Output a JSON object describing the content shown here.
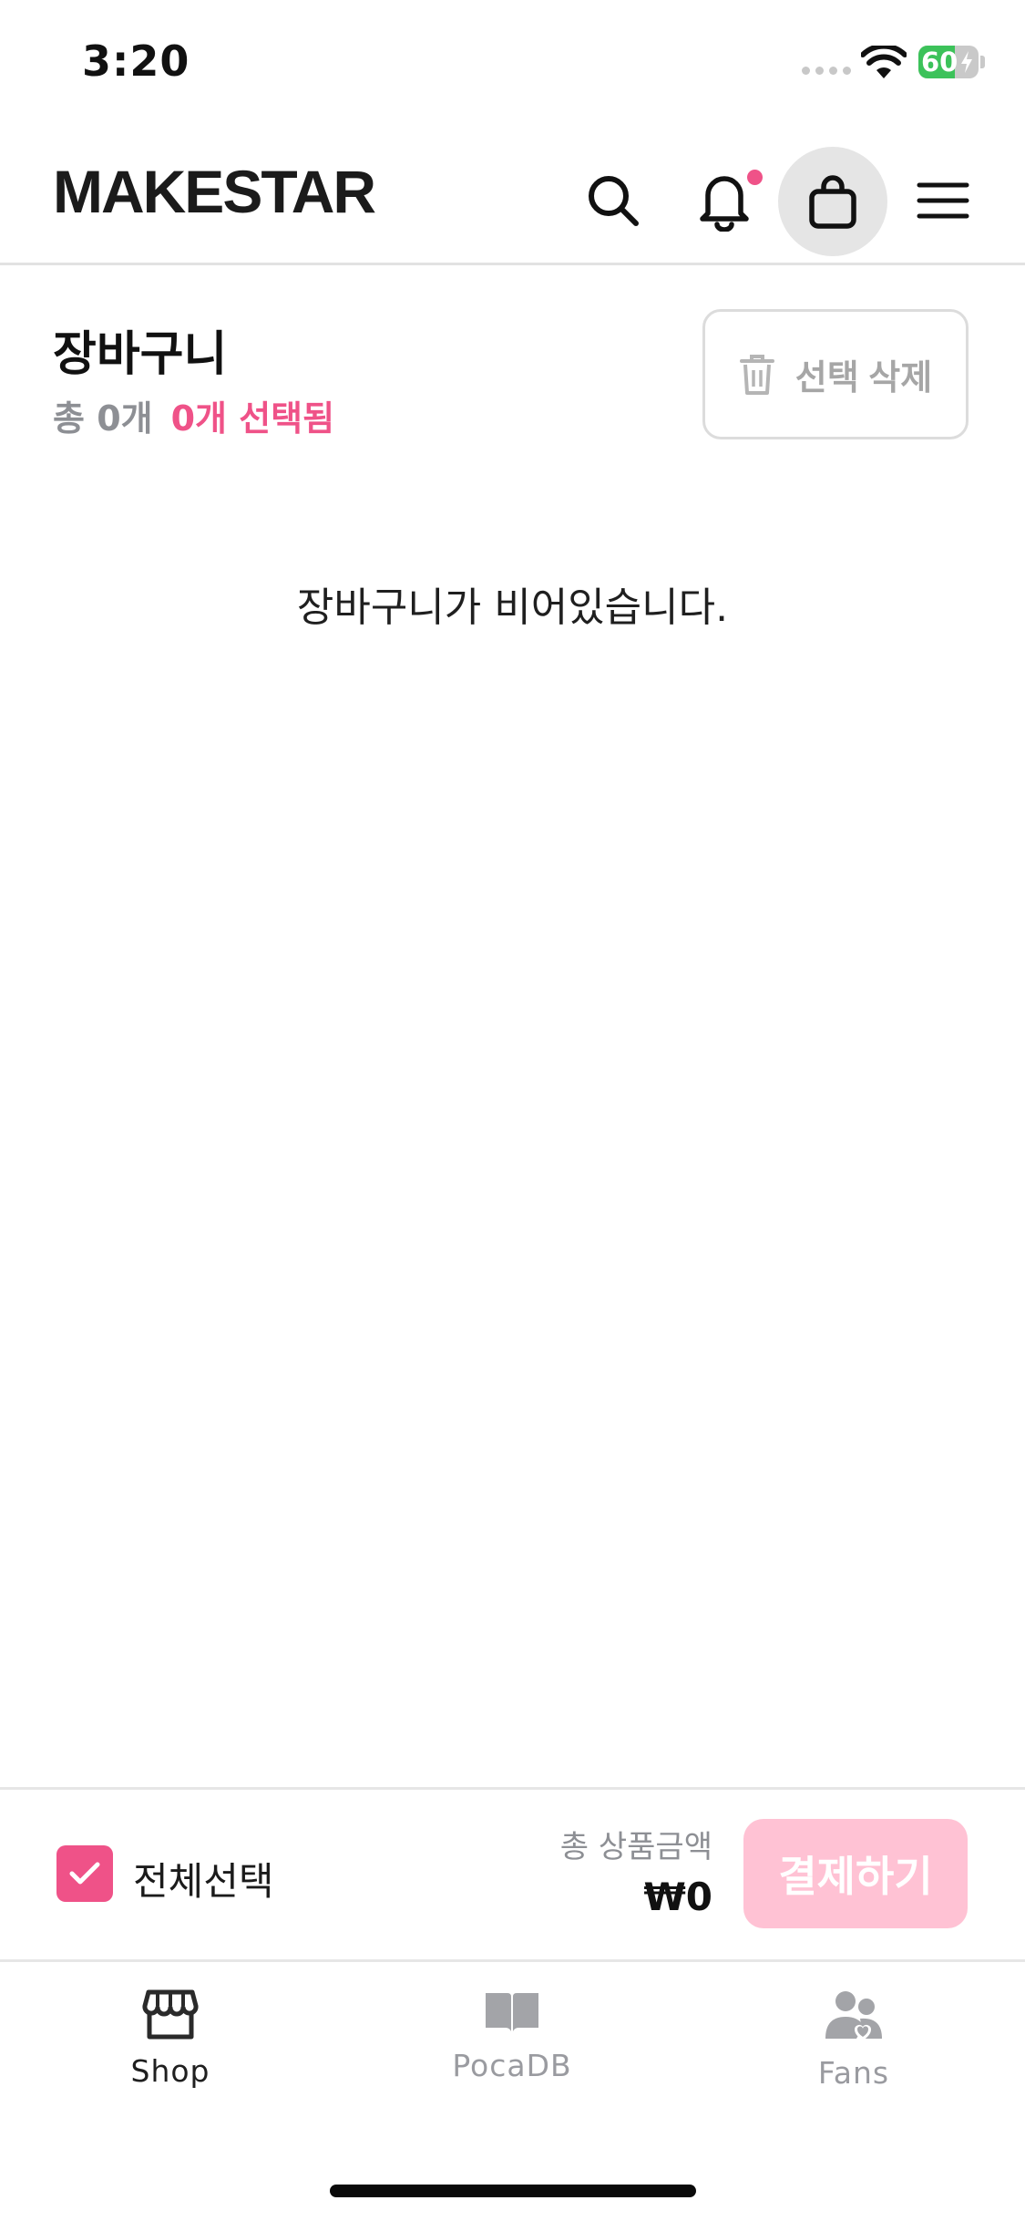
{
  "status_bar": {
    "time": "3:20",
    "battery_level": "60",
    "battery_percent": 60,
    "battery_color": "#3cc25a"
  },
  "header": {
    "logo": "MAKESTAR",
    "icons": [
      "search-icon",
      "bell-icon",
      "shopping-bag-icon",
      "hamburger-menu-icon"
    ],
    "notification_dot_color": "#ef5288"
  },
  "cart": {
    "title": "장바구니",
    "total_count": "총 0개",
    "selected_count": "0개 선택됨",
    "delete_selected_label": "선택 삭제",
    "empty_message": "장바구니가 비어있습니다."
  },
  "checkout_bar": {
    "select_all_label": "전체선택",
    "select_all_checked": true,
    "total_label": "총 상품금액",
    "total_value": "₩0",
    "checkout_label": "결제하기"
  },
  "tabs": [
    {
      "label": "Shop",
      "icon": "storefront-icon",
      "active": true
    },
    {
      "label": "PocaDB",
      "icon": "book-icon",
      "active": false
    },
    {
      "label": "Fans",
      "icon": "users-heart-icon",
      "active": false
    }
  ],
  "colors": {
    "accent": "#ef5288",
    "checkout_disabled": "#ffc2d4",
    "muted_text": "#8d8f94"
  }
}
